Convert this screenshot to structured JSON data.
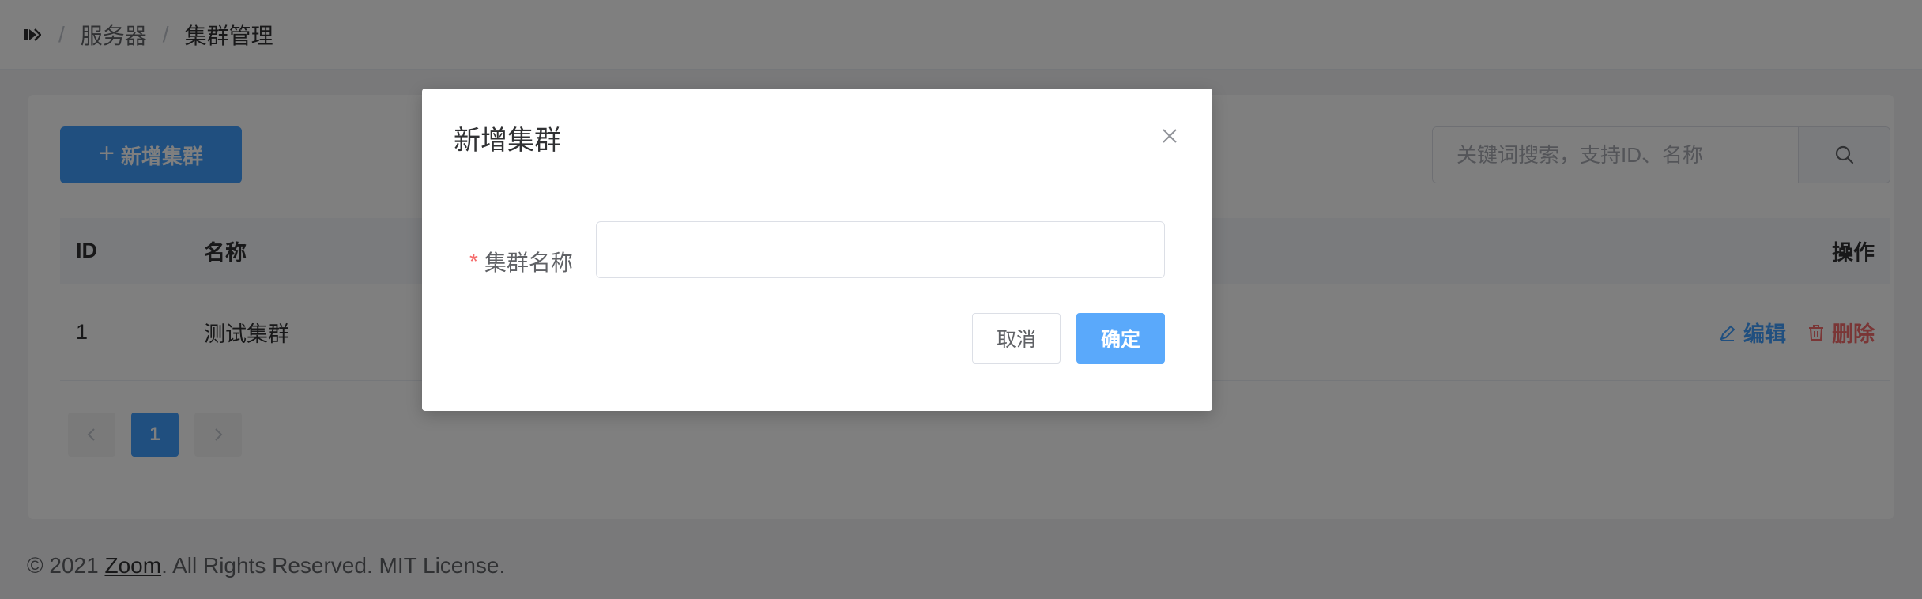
{
  "breadcrumb": {
    "items": [
      "服务器",
      "集群管理"
    ],
    "separator": "/"
  },
  "toolbar": {
    "add_label": "新增集群",
    "search_placeholder": "关键词搜索，支持ID、名称"
  },
  "table": {
    "headers": {
      "id": "ID",
      "name": "名称",
      "ops": "操作"
    },
    "rows": [
      {
        "id": "1",
        "name": "测试集群",
        "edit_label": "编辑",
        "delete_label": "删除"
      }
    ]
  },
  "pagination": {
    "current": "1"
  },
  "footer": {
    "prefix": "© 2021 ",
    "link": "Zoom",
    "suffix": ". All Rights Reserved. MIT License."
  },
  "dialog": {
    "title": "新增集群",
    "field_label": "集群名称",
    "required_mark": "*",
    "field_value": "",
    "cancel_label": "取消",
    "confirm_label": "确定"
  },
  "colors": {
    "primary": "#409eff",
    "danger": "#f56c6c",
    "overlay": "rgba(0,0,0,0.5)"
  }
}
